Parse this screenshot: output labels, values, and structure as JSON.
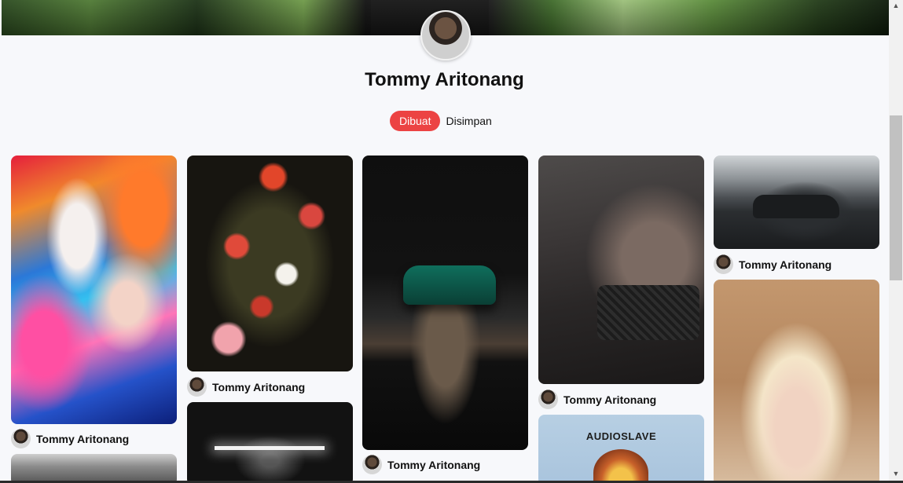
{
  "profile": {
    "name": "Tommy Aritonang"
  },
  "tabs": [
    {
      "label": "Dibuat",
      "active": true
    },
    {
      "label": "Disimpan",
      "active": false
    }
  ],
  "pins": [
    {
      "owner": "Tommy Aritonang",
      "art": "abstract colorful sky painting"
    },
    {
      "owner": "Tommy Aritonang",
      "art": "dutch still life flowers"
    },
    {
      "owner": "Tommy Aritonang",
      "art": "green classic mercedes"
    },
    {
      "owner": "Tommy Aritonang",
      "art": "audi r8 front"
    },
    {
      "owner": "Tommy Aritonang",
      "art": "black audi in garage"
    },
    {
      "owner": "",
      "art": "dark room with ceiling lamp"
    },
    {
      "owner": "",
      "art": "street scene"
    },
    {
      "owner": "",
      "art": "audioslave album cover",
      "title": "AUDIOSLAVE"
    },
    {
      "owner": "",
      "art": "blonde portrait"
    }
  ],
  "icons": {
    "scroll_up": "triangle-up-icon",
    "scroll_down": "triangle-down-icon"
  },
  "scroll_glyphs": {
    "up": "▲",
    "down": "▼"
  },
  "colors": {
    "accent": "#ec4343",
    "background": "#f7f8fb"
  }
}
